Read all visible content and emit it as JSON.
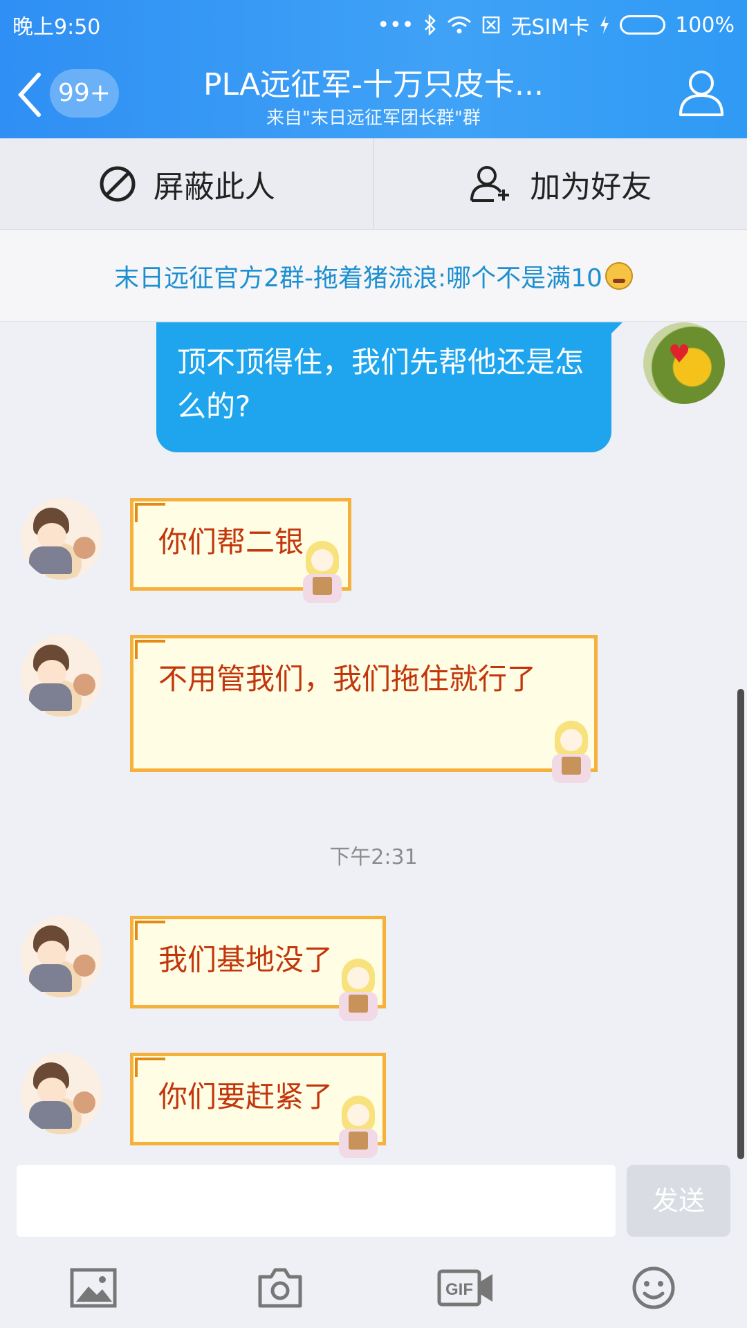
{
  "status_bar": {
    "time": "晚上9:50",
    "dots": "•••",
    "sim": "无SIM卡",
    "battery": "100%",
    "battery_level": 1.0
  },
  "header": {
    "unread_badge": "99+",
    "title": "PLA远征军-十万只皮卡...",
    "subtitle": "来自\"末日远征军团长群\"群"
  },
  "actions": {
    "block_label": "屏蔽此人",
    "add_friend_label": "加为好友"
  },
  "notice": {
    "text": "末日远征官方2群-拖着猪流浪:哪个不是满10"
  },
  "messages": [
    {
      "from": "me",
      "text": "顶不顶得住，我们先帮他还是怎么的?"
    },
    {
      "from": "other",
      "text": "你们帮二银"
    },
    {
      "from": "other",
      "text": "不用管我们，我们拖住就行了"
    },
    {
      "from": "other",
      "text": "我们基地没了"
    },
    {
      "from": "other",
      "text": "你们要赶紧了"
    }
  ],
  "time_separator": "下午2:31",
  "input": {
    "send_label": "发送"
  },
  "toolbar": {
    "gif_label": "GIF",
    "icons": [
      "image-icon",
      "camera-icon",
      "gif-icon",
      "emoji-icon"
    ]
  },
  "colors": {
    "header_blue": "#2f8ff4",
    "my_bubble": "#1ea5ee",
    "other_bubble_border": "#f5b13b",
    "other_text": "#c2360c",
    "notice_text": "#1c8fd0"
  }
}
